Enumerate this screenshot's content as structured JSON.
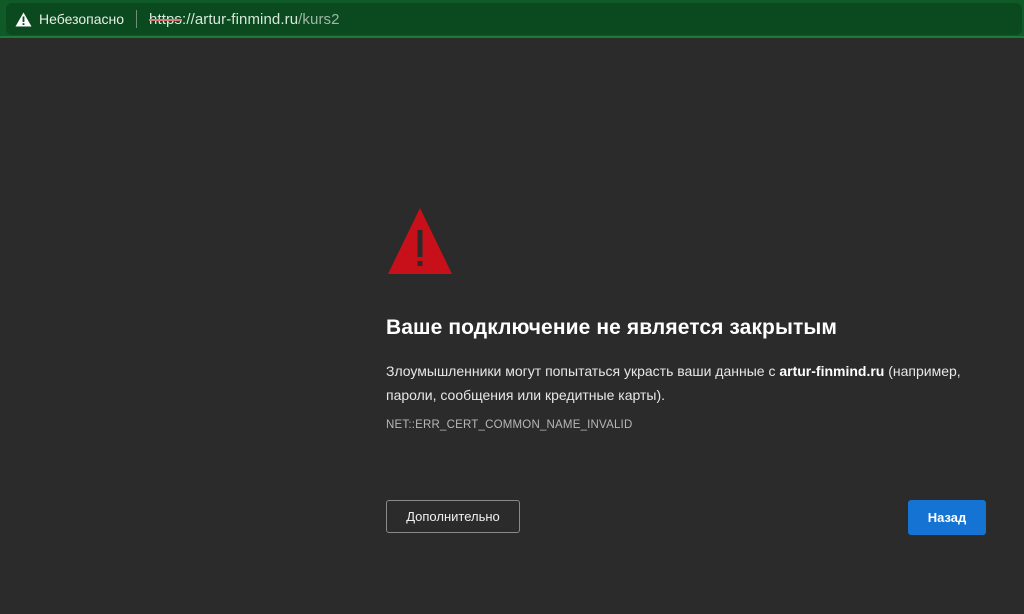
{
  "addressbar": {
    "security_icon": "warning-triangle-icon",
    "security_label": "Небезопасно",
    "url_scheme": "https",
    "url_sep": "://",
    "url_host": "artur-finmind.ru",
    "url_path": "/kurs2"
  },
  "error": {
    "icon": "large-warning-triangle-icon",
    "icon_color": "#c8101a",
    "title": "Ваше подключение не является закрытым",
    "description_prefix": "Злоумышленники могут попытаться украсть ваши данные с ",
    "description_host": "artur-finmind.ru",
    "description_suffix": " (например, пароли, сообщения или кредитные карты).",
    "code": "NET::ERR_CERT_COMMON_NAME_INVALID"
  },
  "buttons": {
    "advanced_label": "Дополнительно",
    "back_label": "Назад",
    "back_color": "#1473d3"
  },
  "colors": {
    "background": "#2b2b2b",
    "addressbar": "#0f5a27"
  }
}
